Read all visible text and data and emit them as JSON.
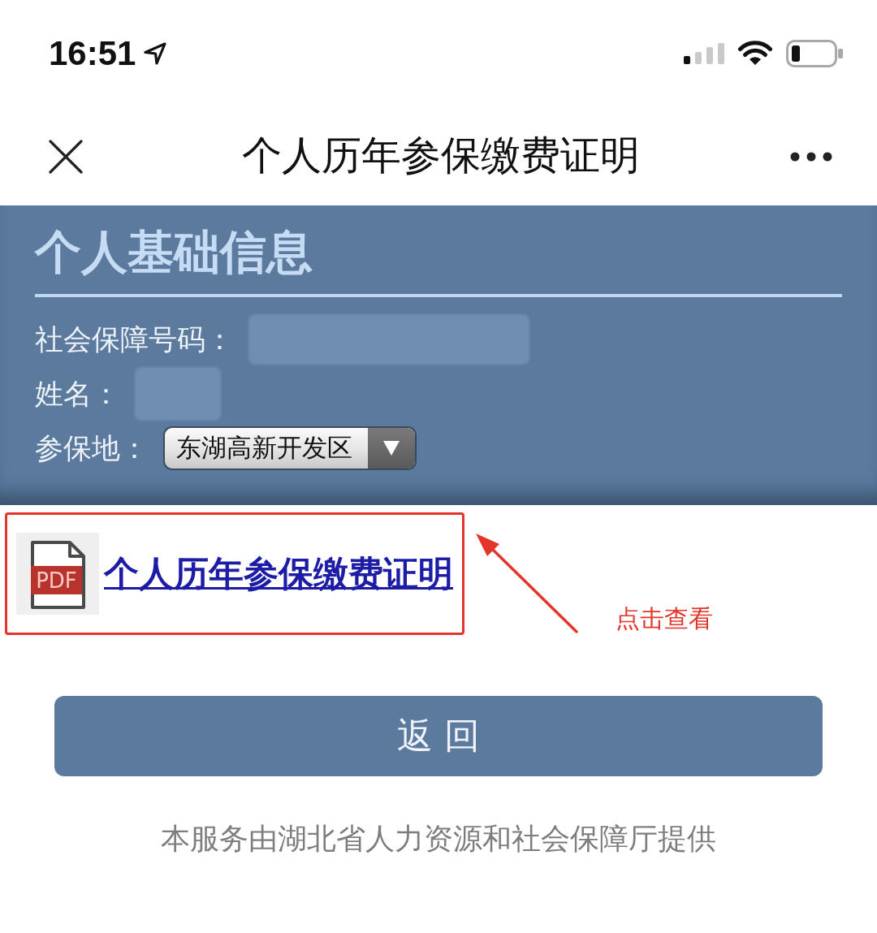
{
  "status_bar": {
    "time": "16:51"
  },
  "nav_bar": {
    "title": "个人历年参保缴费证明"
  },
  "info_panel": {
    "heading": "个人基础信息",
    "fields": [
      {
        "kind": "text",
        "label": "社会保障号码：",
        "redacted": true
      },
      {
        "kind": "text",
        "label": "姓名：",
        "redacted": true
      },
      {
        "kind": "select",
        "label": "参保地：",
        "value": "东湖高新开发区"
      }
    ]
  },
  "document": {
    "file_type": "PDF",
    "link": "个人历年参保缴费证明"
  },
  "annotation": {
    "text": "点击查看"
  },
  "back_button": {
    "label": "返 回"
  },
  "footer": {
    "text": "本服务由湖北省人力资源和社会保障厅提供"
  }
}
